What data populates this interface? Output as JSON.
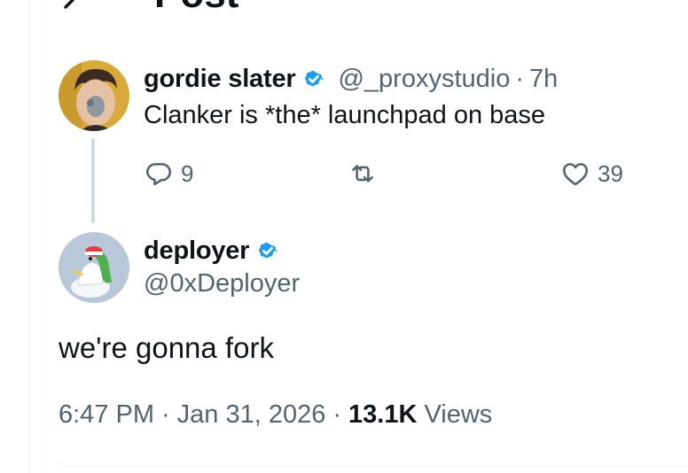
{
  "header": {
    "title": "Post"
  },
  "parent_tweet": {
    "display_name": "gordie slater",
    "handle": "@_proxystudio",
    "separator": "·",
    "time": "7h",
    "text": "Clanker is *the* launchpad on base",
    "replies": "9",
    "likes": "39"
  },
  "main_tweet": {
    "display_name": "deployer",
    "handle": "@0xDeployer",
    "text": "we're gonna fork",
    "time": "6:47 PM",
    "date": "Jan 31, 2026",
    "separator": "·",
    "views_count": "13.1K",
    "views_label": "Views"
  },
  "colors": {
    "verified_blue": "#1d9bf0",
    "text_primary": "#0f1419",
    "text_secondary": "#536471",
    "thread_line": "#cfd9de"
  }
}
